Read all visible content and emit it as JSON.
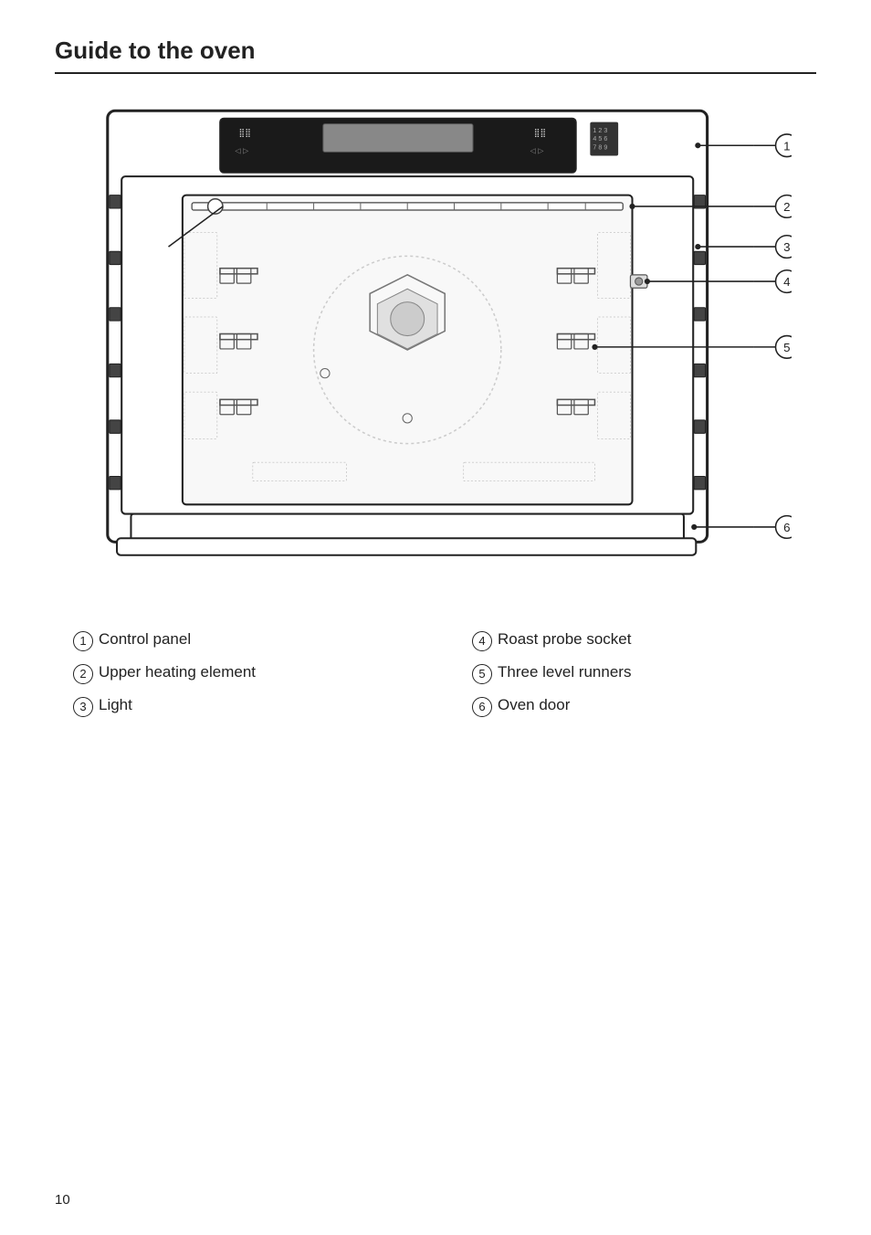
{
  "page": {
    "title": "Guide to the oven",
    "page_number": "10"
  },
  "labels": [
    {
      "num": "1",
      "text": "Control panel",
      "col": 0
    },
    {
      "num": "2",
      "text": "Upper heating element",
      "col": 0
    },
    {
      "num": "3",
      "text": "Light",
      "col": 0
    },
    {
      "num": "4",
      "text": "Roast probe socket",
      "col": 1
    },
    {
      "num": "5",
      "text": "Three level runners",
      "col": 1
    },
    {
      "num": "6",
      "text": "Oven door",
      "col": 1
    }
  ]
}
